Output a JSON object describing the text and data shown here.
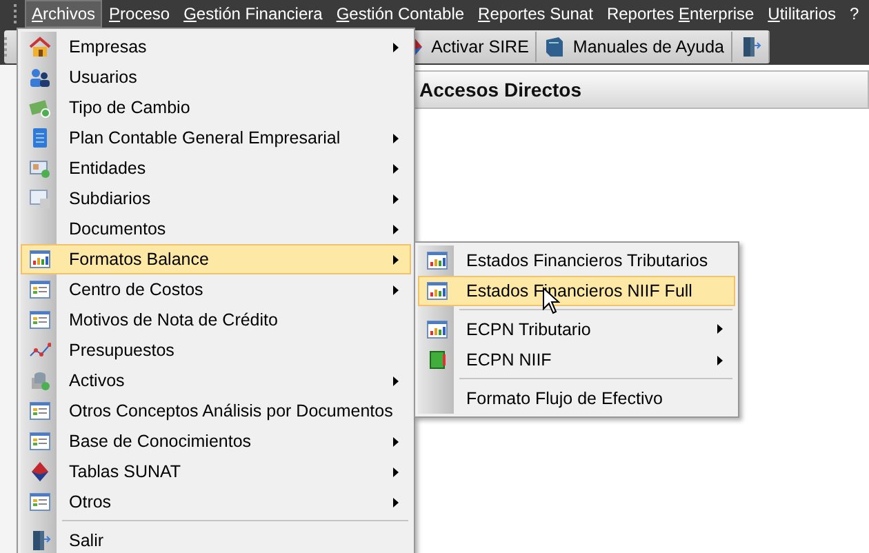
{
  "menu_bar": [
    {
      "key": "A",
      "after": "rchivos",
      "selected": true
    },
    {
      "key": "P",
      "after": "roceso",
      "selected": false
    },
    {
      "key": "G",
      "after": "estión Financiera",
      "selected": false
    },
    {
      "key": "G",
      "after": "estión Contable",
      "selected": false
    },
    {
      "key": "R",
      "after": "eportes Sunat",
      "selected": false
    },
    {
      "before": "Reportes ",
      "key": "E",
      "after": "nterprise",
      "selected": false
    },
    {
      "key": "U",
      "after": "tilitarios",
      "selected": false
    },
    {
      "after": "?",
      "selected": false
    }
  ],
  "toolbar": [
    {
      "label": "Activar SIRE"
    },
    {
      "label": "Manuales de Ayuda"
    }
  ],
  "panel": {
    "title": "Accesos Directos"
  },
  "menu": [
    {
      "label": "Empresas",
      "submenu": true,
      "selected": false
    },
    {
      "label": "Usuarios",
      "submenu": false,
      "selected": false
    },
    {
      "label": "Tipo de Cambio",
      "submenu": false,
      "selected": false
    },
    {
      "label": "Plan Contable General Empresarial",
      "submenu": true,
      "selected": false
    },
    {
      "label": "Entidades",
      "submenu": true,
      "selected": false
    },
    {
      "label": "Subdiarios",
      "submenu": true,
      "selected": false
    },
    {
      "label": "Documentos",
      "submenu": true,
      "selected": false
    },
    {
      "label": "Formatos Balance",
      "submenu": true,
      "selected": true
    },
    {
      "label": "Centro de Costos",
      "submenu": true,
      "selected": false
    },
    {
      "label": "Motivos de Nota de Crédito",
      "submenu": false,
      "selected": false
    },
    {
      "label": "Presupuestos",
      "submenu": false,
      "selected": false
    },
    {
      "label": "Activos",
      "submenu": true,
      "selected": false
    },
    {
      "label": "Otros Conceptos Análisis por Documentos",
      "submenu": false,
      "selected": false
    },
    {
      "label": "Base de Conocimientos",
      "submenu": true,
      "selected": false
    },
    {
      "label": "Tablas SUNAT",
      "submenu": true,
      "selected": false
    },
    {
      "label": "Otros",
      "submenu": true,
      "selected": false
    },
    {
      "label": "Salir",
      "submenu": false,
      "selected": false,
      "separator_before": true
    }
  ],
  "submenu": [
    {
      "label": "Estados Financieros Tributarios",
      "submenu": false,
      "selected": false
    },
    {
      "label": "Estados Financieros NIIF Full",
      "submenu": false,
      "selected": true
    },
    {
      "label": "ECPN Tributario",
      "submenu": true,
      "selected": false,
      "separator_before": true
    },
    {
      "label": "ECPN NIIF",
      "submenu": true,
      "selected": false
    },
    {
      "label": "Formato Flujo de Efectivo",
      "submenu": false,
      "selected": false,
      "separator_before": true
    }
  ]
}
